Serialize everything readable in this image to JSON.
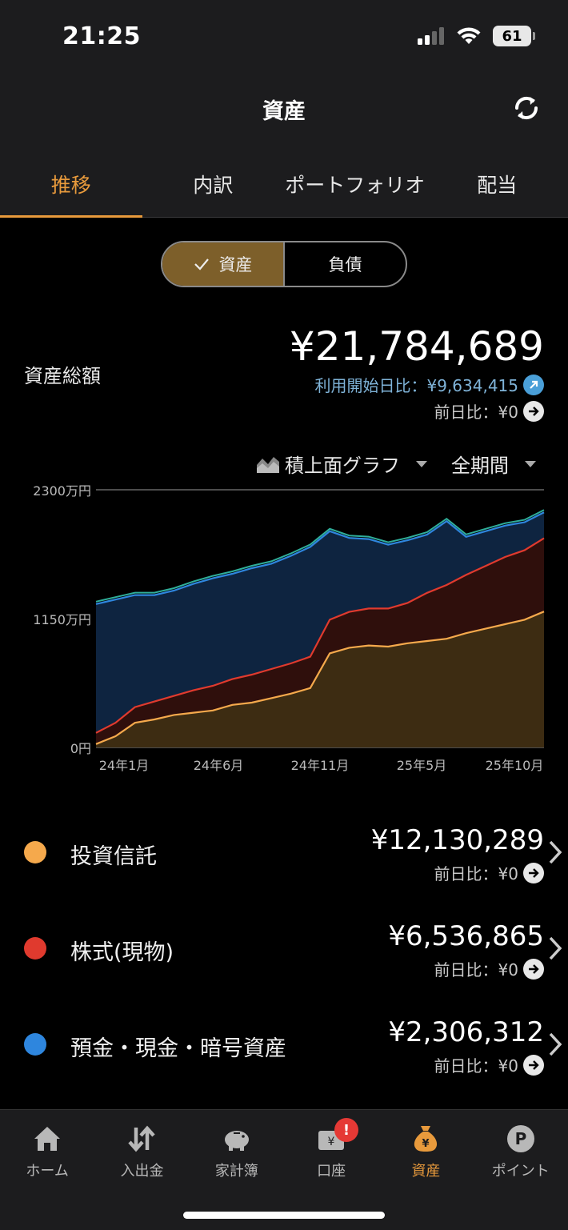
{
  "status": {
    "time": "21:25",
    "battery": "61"
  },
  "header": {
    "title": "資産"
  },
  "tabs": [
    {
      "label": "推移",
      "active": true
    },
    {
      "label": "内訳",
      "active": false
    },
    {
      "label": "ポートフォリオ",
      "active": false
    },
    {
      "label": "配当",
      "active": false
    }
  ],
  "segment": {
    "assets": "資産",
    "liabilities": "負債",
    "selected": "assets"
  },
  "summary": {
    "label": "資産総額",
    "total": "¥21,784,689",
    "since_start": "利用開始日比：¥9,634,415",
    "prev_day": "前日比：¥0"
  },
  "chart_controls": {
    "graph_type": "積上面グラフ",
    "period": "全期間"
  },
  "chart_data": {
    "type": "area",
    "stacked": true,
    "y_ticks": [
      "2300万円",
      "1150万円",
      "0円"
    ],
    "x_ticks": [
      "24年1月",
      "24年6月",
      "24年11月",
      "25年5月",
      "25年10月"
    ],
    "ylim": [
      0,
      23000000
    ],
    "x": [
      "2023-11",
      "2023-12",
      "2024-01",
      "2024-02",
      "2024-03",
      "2024-04",
      "2024-05",
      "2024-06",
      "2024-07",
      "2024-08",
      "2024-09",
      "2024-10",
      "2024-11",
      "2024-12",
      "2025-01",
      "2025-02",
      "2025-03",
      "2025-04",
      "2025-05",
      "2025-06",
      "2025-07",
      "2025-08",
      "2025-09",
      "2025-10"
    ],
    "series": [
      {
        "name": "投資信託",
        "color": "#f5a94c",
        "values": [
          0.3,
          1.0,
          2.2,
          2.5,
          2.9,
          3.1,
          3.3,
          3.8,
          4.0,
          4.4,
          4.8,
          5.3,
          8.4,
          8.9,
          9.1,
          9.0,
          9.3,
          9.5,
          9.7,
          10.2,
          10.6,
          11.0,
          11.4,
          12.13
        ]
      },
      {
        "name": "株式(現物)",
        "color": "#e03a2e",
        "values": [
          1.0,
          1.2,
          1.4,
          1.6,
          1.7,
          2.0,
          2.2,
          2.3,
          2.5,
          2.6,
          2.7,
          2.8,
          3.0,
          3.2,
          3.3,
          3.4,
          3.6,
          4.3,
          4.8,
          5.2,
          5.6,
          6.0,
          6.2,
          6.54
        ]
      },
      {
        "name": "預金・現金・暗号資産",
        "color": "#2e86de",
        "values": [
          11.5,
          11.0,
          10.0,
          9.5,
          9.4,
          9.5,
          9.6,
          9.4,
          9.5,
          9.4,
          9.6,
          9.8,
          7.9,
          6.6,
          6.2,
          5.7,
          5.6,
          5.2,
          5.7,
          3.4,
          3.1,
          2.8,
          2.5,
          2.31
        ]
      }
    ],
    "values_unit": "百万円"
  },
  "assets": [
    {
      "name": "投資信託",
      "value": "¥12,130,289",
      "prev": "前日比：¥0",
      "color": "#f5a94c"
    },
    {
      "name": "株式(現物)",
      "value": "¥6,536,865",
      "prev": "前日比：¥0",
      "color": "#e03a2e"
    },
    {
      "name": "預金・現金・暗号資産",
      "value": "¥2,306,312",
      "prev": "前日比：¥0",
      "color": "#2e86de"
    }
  ],
  "nav": [
    {
      "label": "ホーム",
      "icon": "home-icon"
    },
    {
      "label": "入出金",
      "icon": "transfer-icon"
    },
    {
      "label": "家計簿",
      "icon": "piggy-bank-icon"
    },
    {
      "label": "口座",
      "icon": "wallet-icon",
      "badge": "!"
    },
    {
      "label": "資産",
      "icon": "money-bag-icon",
      "active": true
    },
    {
      "label": "ポイント",
      "icon": "points-icon"
    }
  ]
}
